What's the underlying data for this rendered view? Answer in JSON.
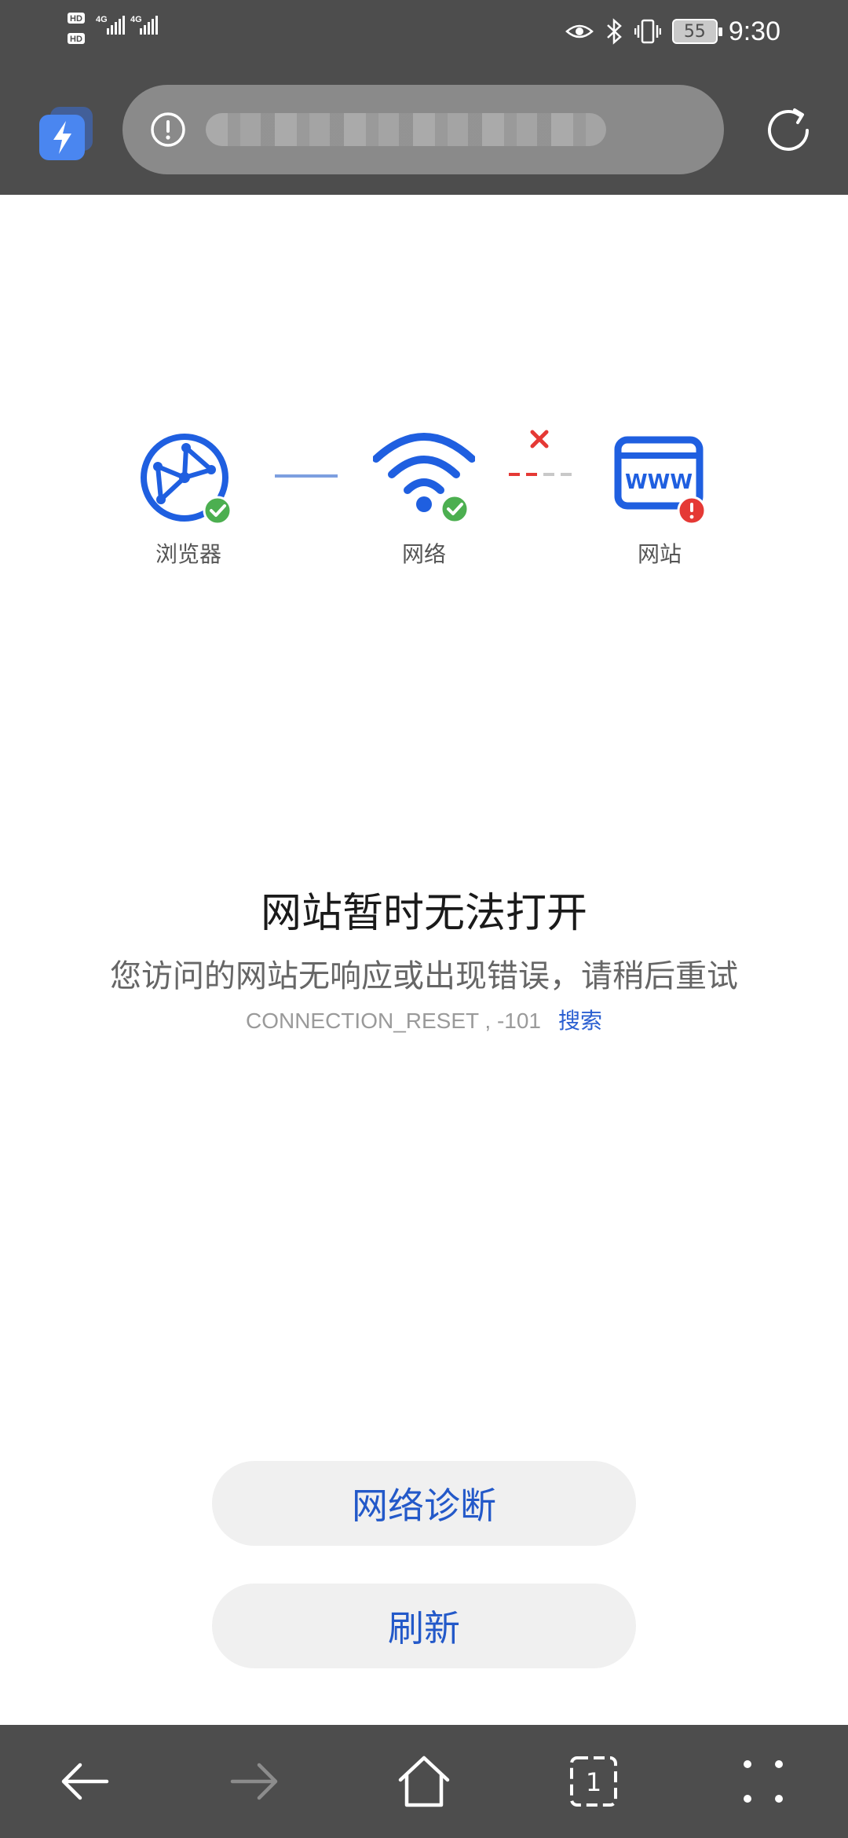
{
  "status_bar": {
    "time": "9:30",
    "battery": "55",
    "network_labels": [
      "HD",
      "HD",
      "4G",
      "4G"
    ],
    "icons": [
      "eye-icon",
      "bluetooth-icon",
      "vibrate-icon",
      "battery-icon"
    ]
  },
  "browser": {
    "quick_app_icon": "lightning-icon",
    "address_info_icon": "info-icon",
    "url": "",
    "reload_icon": "reload-icon"
  },
  "diagram": {
    "nodes": [
      {
        "label": "浏览器",
        "icon": "browser-globe-icon",
        "status": "ok"
      },
      {
        "label": "网络",
        "icon": "wifi-icon",
        "status": "ok"
      },
      {
        "label": "网站",
        "icon": "website-www-icon",
        "status": "error"
      }
    ],
    "www_text": "WWW",
    "colors": {
      "primary": "#1f5fe0",
      "ok": "#4caf50",
      "error": "#e53935"
    }
  },
  "error": {
    "title": "网站暂时无法打开",
    "description": "您访问的网站无响应或出现错误，请稍后重试",
    "code": "CONNECTION_RESET , -101",
    "search_link": "搜索"
  },
  "actions": {
    "diagnose": "网络诊断",
    "refresh": "刷新"
  },
  "bottom_nav": {
    "tab_count": "1",
    "items": [
      "back-icon",
      "forward-icon",
      "home-icon",
      "tabs-icon",
      "menu-icon"
    ]
  }
}
